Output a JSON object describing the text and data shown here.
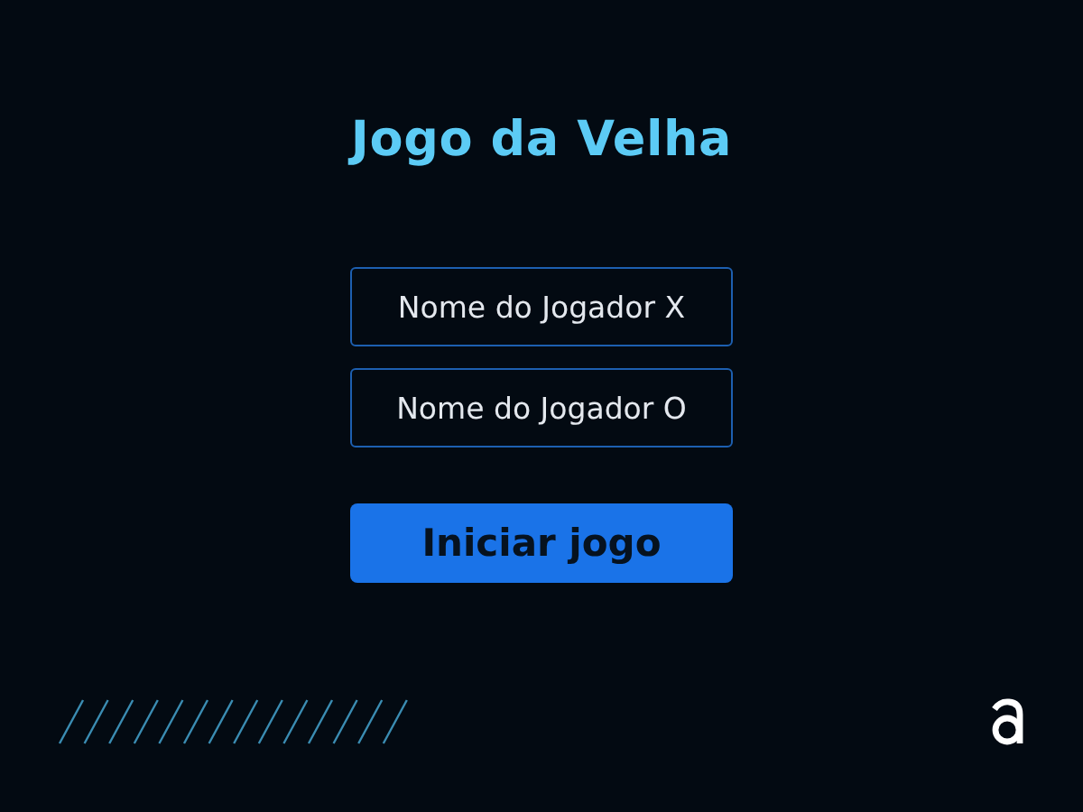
{
  "title": "Jogo da Velha",
  "fields": [
    {
      "placeholder": "Nome do Jogador X"
    },
    {
      "placeholder": "Nome do Jogador O"
    }
  ],
  "button": "Iniciar jogo"
}
